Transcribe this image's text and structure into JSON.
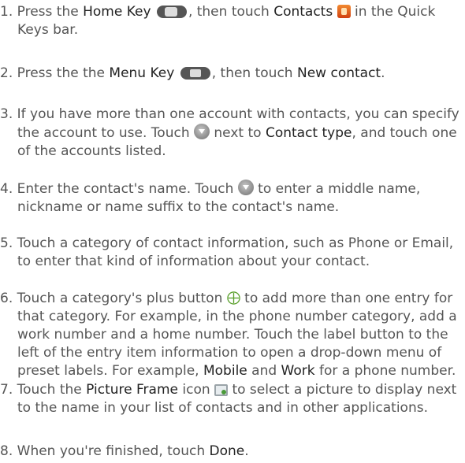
{
  "steps": [
    {
      "num": "1.",
      "t1": "Press the ",
      "b1": "Home Key",
      "t2": ", then touch ",
      "b2": "Contacts",
      "t3": " in the Quick Keys bar."
    },
    {
      "num": "2.",
      "t1": "Press the the ",
      "b1": "Menu Key",
      "t2": ", then touch ",
      "b2": "New contact",
      "t3": "."
    },
    {
      "num": "3.",
      "t1": "If you have more than one account with contacts, you can specify the account to use. Touch",
      "t2": "next to ",
      "b1": "Contact type",
      "t3": ", and touch one of the accounts listed."
    },
    {
      "num": "4.",
      "t1": "Enter the contact's name. Touch",
      "t2": "to enter a middle name, nickname or name suffix to the contact's name."
    },
    {
      "num": "5.",
      "t1": "Touch a category of contact information, such as Phone or Email, to enter that kind of information about your contact."
    },
    {
      "num": "6.",
      "t1": "Touch a category's plus button",
      "t2": "to add more than one entry for that category. For example, in the phone number category, add a work number and a home number. Touch the label button to the left of the entry item information to open a drop-down menu of preset labels. For example, ",
      "b1": "Mobile",
      "t3": " and ",
      "b2": "Work",
      "t4": " for a phone number."
    },
    {
      "num": "7.",
      "t1": "Touch the ",
      "b1": "Picture Frame",
      "t2": " icon",
      "t3": "to select a picture to display next to the name in your list of contacts and in other applications."
    },
    {
      "num": "8.",
      "t1": "When you're finished, touch ",
      "b1": "Done",
      "t2": "."
    }
  ],
  "icons": {
    "home_key": "home-key-icon",
    "contacts": "contacts-app-icon",
    "menu_key": "menu-key-icon",
    "dropdown": "dropdown-circle-icon",
    "plus": "plus-circle-icon",
    "picture_frame": "picture-frame-icon"
  },
  "colors": {
    "text": "#555555",
    "emphasis": "#222222"
  }
}
